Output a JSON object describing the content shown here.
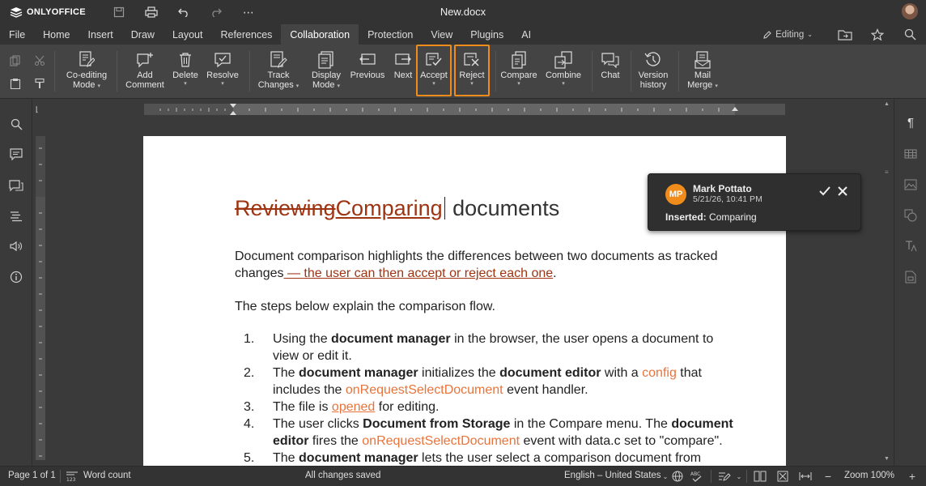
{
  "app": {
    "logo_text": "ONLYOFFICE",
    "document_title": "New.docx"
  },
  "menu": {
    "tabs": [
      "File",
      "Home",
      "Insert",
      "Draw",
      "Layout",
      "References",
      "Collaboration",
      "Protection",
      "View",
      "Plugins",
      "AI"
    ],
    "active_tab": "Collaboration",
    "mode_label": "Editing"
  },
  "toolbar": {
    "co_editing": [
      "Co-editing",
      "Mode"
    ],
    "add_comment": [
      "Add",
      "Comment"
    ],
    "delete": "Delete",
    "resolve": "Resolve",
    "track_changes": [
      "Track",
      "Changes"
    ],
    "display_mode": [
      "Display",
      "Mode"
    ],
    "previous": "Previous",
    "next": "Next",
    "accept": "Accept",
    "reject": "Reject",
    "compare": "Compare",
    "combine": "Combine",
    "chat": "Chat",
    "version_history": [
      "Version",
      "history"
    ],
    "mail_merge": [
      "Mail",
      "Merge"
    ],
    "highlight_color": "#f08c1b"
  },
  "document": {
    "heading_deleted": "Reviewing",
    "heading_inserted": "Comparing",
    "heading_rest": " documents",
    "p1_text": "Document comparison highlights the differences between two documents as tracked changes",
    "p1_inserted": " — the user can then accept or reject each one",
    "p1_end": ".",
    "p2_text": "The steps below explain the comparison flow.",
    "list": [
      {
        "num": "1.",
        "parts": [
          {
            "t": "Using the "
          },
          {
            "t": "document manager",
            "b": true
          },
          {
            "t": " in the browser, the user opens a document to view or edit it."
          }
        ]
      },
      {
        "num": "2.",
        "parts": [
          {
            "t": "The "
          },
          {
            "t": "document manager",
            "b": true
          },
          {
            "t": " initializes the "
          },
          {
            "t": "document editor",
            "b": true
          },
          {
            "t": " with a "
          },
          {
            "t": "config",
            "link": true
          },
          {
            "t": " that includes the "
          },
          {
            "t": "onRequestSelectDocument",
            "link": true
          },
          {
            "t": " event handler."
          }
        ]
      },
      {
        "num": "3.",
        "parts": [
          {
            "t": "The file is "
          },
          {
            "t": "opened",
            "link_u": true
          },
          {
            "t": " for editing."
          }
        ]
      },
      {
        "num": "4.",
        "parts": [
          {
            "t": "The user clicks "
          },
          {
            "t": "Document from Storage",
            "b": true
          },
          {
            "t": " in the Compare menu. The "
          },
          {
            "t": "document editor",
            "b": true
          },
          {
            "t": " fires the "
          },
          {
            "t": "onRequestSelectDocument",
            "link": true
          },
          {
            "t": " event with data.c set to \"compare\"."
          }
        ]
      },
      {
        "num": "5.",
        "parts": [
          {
            "t": "The "
          },
          {
            "t": "document manager",
            "b": true
          },
          {
            "t": " lets the user select a comparison document from"
          }
        ]
      }
    ]
  },
  "comment": {
    "initials": "MP",
    "author": "Mark Pottato",
    "date": "5/21/26, 10:41 PM",
    "label": "Inserted:",
    "value": " Comparing",
    "avatar_color": "#f08c1b"
  },
  "status": {
    "page": "Page 1 of 1",
    "word_count": "Word count",
    "saved": "All changes saved",
    "language": "English – United States",
    "zoom": "Zoom 100%"
  }
}
